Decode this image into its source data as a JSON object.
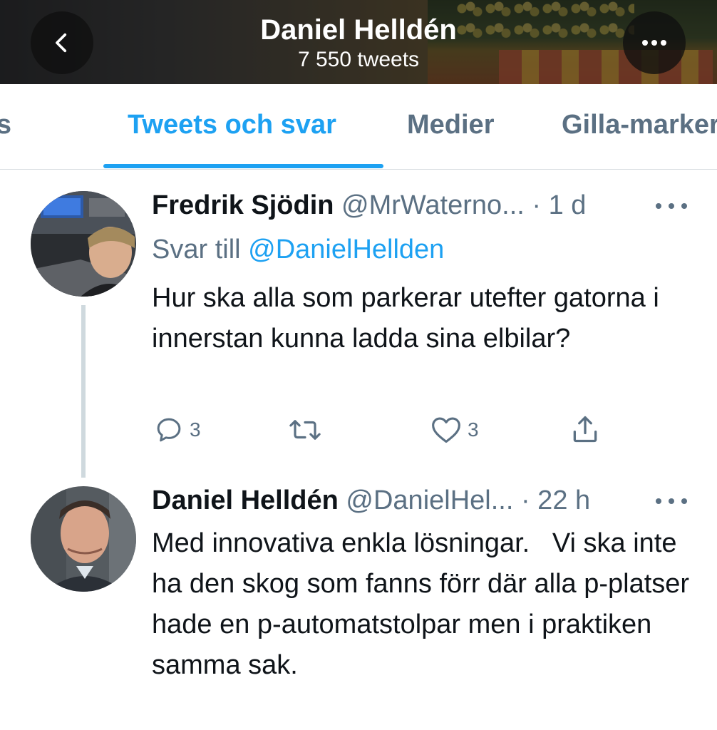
{
  "header": {
    "title": "Daniel Helldén",
    "tweet_count": "7 550 tweets"
  },
  "tabs": [
    {
      "label": "Tweets",
      "active": false
    },
    {
      "label": "Tweets och svar",
      "active": true
    },
    {
      "label": "Medier",
      "active": false
    },
    {
      "label": "Gilla-markeringar",
      "active": false
    }
  ],
  "tweets": [
    {
      "name": "Fredrik Sjödin",
      "handle": "@MrWaterno...",
      "time": "· 1 d",
      "reply_prefix": "Svar till",
      "reply_mention": "@DanielHellden",
      "text": "Hur ska alla som parkerar utefter gatorna i innerstan kunna ladda sina elbilar?",
      "replies": "3",
      "likes": "3"
    },
    {
      "name": "Daniel Helldén",
      "handle": "@DanielHel...",
      "time": "· 22 h",
      "text": "Med innovativa enkla lösningar.   Vi ska inte ha den skog som fanns förr där alla p-platser hade en p-automatstolpar men i praktiken samma sak."
    }
  ],
  "colors": {
    "accent": "#1da1f2",
    "secondary_text": "#5b7083",
    "primary_text": "#0f1419",
    "divider": "#d6dce0"
  },
  "icons": [
    "chevron-left-icon",
    "more-horizontal-icon",
    "reply-icon",
    "retweet-icon",
    "like-icon",
    "share-icon"
  ]
}
